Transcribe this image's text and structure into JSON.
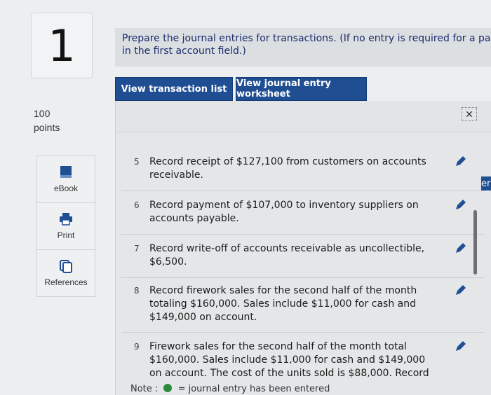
{
  "question": {
    "number": "1",
    "points_value": "100",
    "points_label": "points"
  },
  "sidebar": [
    {
      "label": "eBook",
      "icon": "book-icon"
    },
    {
      "label": "Print",
      "icon": "printer-icon"
    },
    {
      "label": "References",
      "icon": "references-icon"
    }
  ],
  "instructions": {
    "line1": "Prepare the journal entries for transactions. (If no entry is required for a pa",
    "line2": "in the first account field.)"
  },
  "tabs": {
    "transaction_list": "View transaction list",
    "journal_worksheet": "View journal entry worksheet"
  },
  "transactions": [
    {
      "num": "5",
      "text": "Record receipt of $127,100 from customers on accounts receivable."
    },
    {
      "num": "6",
      "text": "Record payment of $107,000 to inventory suppliers on accounts payable."
    },
    {
      "num": "7",
      "text": "Record write-off of accounts receivable as uncollectible, $6,500."
    },
    {
      "num": "8",
      "text": "Record firework sales for the second half of the month totaling $160,000. Sales include $11,000 for cash and $149,000 on account."
    },
    {
      "num": "9",
      "text": "Firework sales for the second half of the month total $160,000. Sales include $11,000 for cash and $149,000 on account. The cost of the units sold is $88,000. Record"
    }
  ],
  "note": {
    "label": "Note :",
    "text": "= journal entry has been entered"
  },
  "edge_tab_text": "er",
  "colors": {
    "accent": "#1f4e93",
    "entered_dot": "#2d8a3e"
  }
}
